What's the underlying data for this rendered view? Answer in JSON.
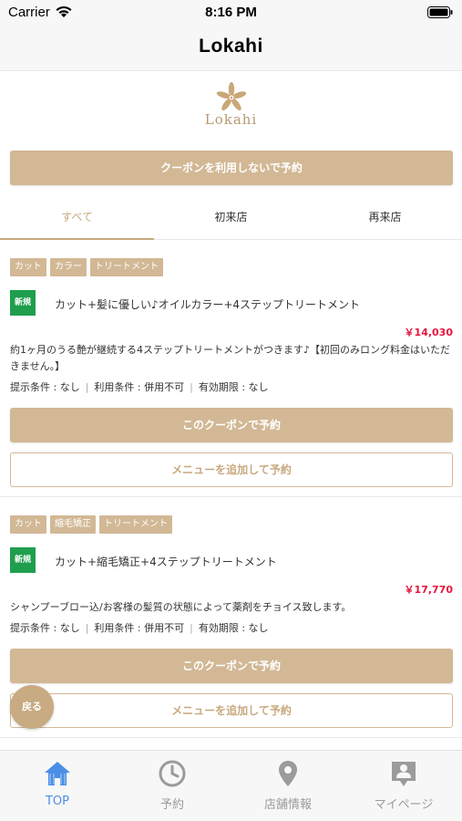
{
  "status_bar": {
    "carrier": "Carrier",
    "time": "8:16 PM"
  },
  "nav": {
    "title": "Lokahi"
  },
  "logo": {
    "text": "Lokahi"
  },
  "reserve_without_coupon_label": "クーポンを利用しないで予約",
  "tabs": [
    {
      "label": "すべて",
      "active": true
    },
    {
      "label": "初来店",
      "active": false
    },
    {
      "label": "再来店",
      "active": false
    }
  ],
  "coupons": [
    {
      "tags": [
        "カット",
        "カラー",
        "トリートメント"
      ],
      "badge": "新規",
      "title": "カット+髪に優しい♪オイルカラー+4ステップトリートメント",
      "price": "￥14,030",
      "description": "約1ヶ月のうる艶が継続する4ステップトリートメントがつきます♪【初回のみロング料金はいただきません。】",
      "conditions": {
        "presentation": "提示条件 : なし",
        "usage": "利用条件 : 併用不可",
        "expiry": "有効期限 : なし"
      },
      "reserve_label": "このクーポンで予約",
      "add_menu_label": "メニューを追加して予約"
    },
    {
      "tags": [
        "カット",
        "縮毛矯正",
        "トリートメント"
      ],
      "badge": "新規",
      "title": "カット+縮毛矯正+4ステップトリートメント",
      "price": "￥17,770",
      "description": "シャンプーブロー込/お客様の髪質の状態によって薬剤をチョイス致します。",
      "conditions": {
        "presentation": "提示条件 : なし",
        "usage": "利用条件 : 併用不可",
        "expiry": "有効期限 : なし"
      },
      "reserve_label": "このクーポンで予約",
      "add_menu_label": "メニューを追加して予約"
    }
  ],
  "back_button": {
    "label": "戻る"
  },
  "tab_bar": [
    {
      "label": "TOP",
      "icon": "home-icon",
      "active": true
    },
    {
      "label": "予約",
      "icon": "clock-icon",
      "active": false
    },
    {
      "label": "店舗情報",
      "icon": "location-pin-icon",
      "active": false
    },
    {
      "label": "マイページ",
      "icon": "user-badge-icon",
      "active": false
    }
  ],
  "colors": {
    "accent": "#d2b895",
    "price": "#e5163f",
    "new_badge": "#1f9e4d",
    "tab_active": "#4a8ee6"
  }
}
